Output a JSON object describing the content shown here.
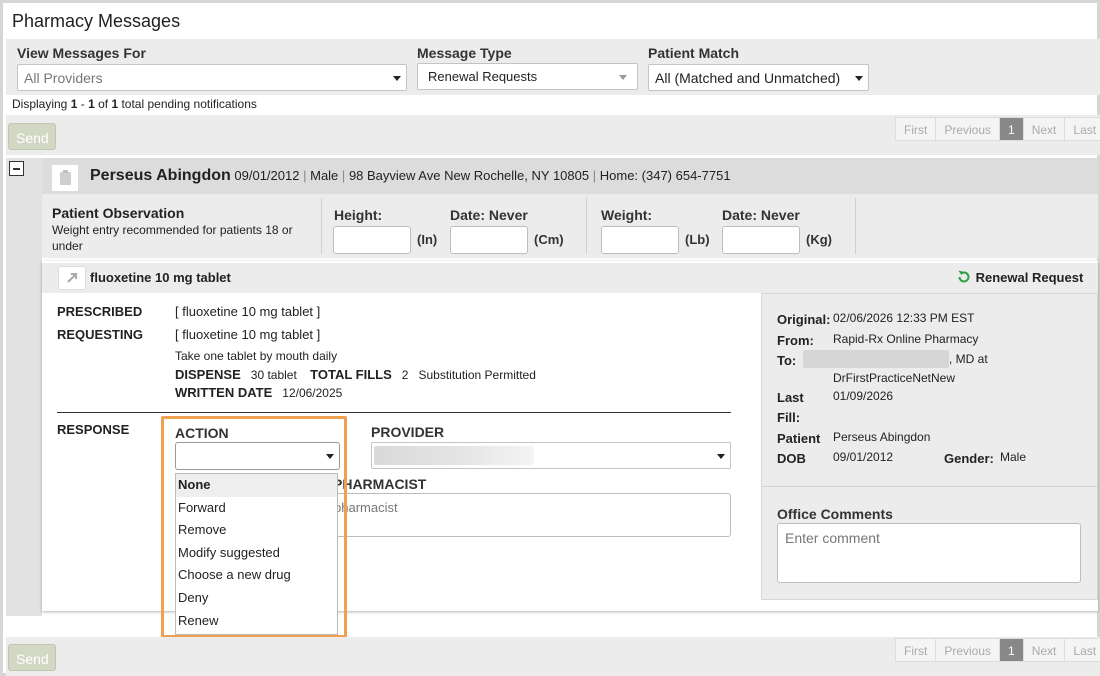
{
  "page": {
    "title": "Pharmacy Messages"
  },
  "filters": {
    "view_messages_for": {
      "label": "View Messages For",
      "placeholder": "All Providers"
    },
    "message_type": {
      "label": "Message Type",
      "value": "Renewal Requests"
    },
    "patient_match": {
      "label": "Patient Match",
      "value": "All (Matched and Unmatched)"
    }
  },
  "summary": {
    "prefix": "Displaying ",
    "from": "1",
    "sep": " - ",
    "to": "1",
    "of": " of ",
    "total": "1",
    "suffix": " total pending notifications"
  },
  "buttons": {
    "send": "Send"
  },
  "pagination": {
    "first": "First",
    "previous": "Previous",
    "current": "1",
    "next": "Next",
    "last": "Last"
  },
  "patient": {
    "name": "Perseus Abingdon",
    "dob": "09/01/2012",
    "gender": "Male",
    "address": "98 Bayview Ave New Rochelle, NY 10805",
    "phone": "Home: (347) 654-7751",
    "sep": "|"
  },
  "observation": {
    "title": "Patient Observation",
    "note": "Weight entry recommended for patients 18 or under",
    "height_label": "Height:",
    "height_date": "Date: Never",
    "unit_in": "(In)",
    "unit_cm": "(Cm)",
    "weight_label": "Weight:",
    "weight_date": "Date: Never",
    "unit_lb": "(Lb)",
    "unit_kg": "(Kg)"
  },
  "rx": {
    "drug": "fluoxetine 10 mg tablet",
    "request_type": "Renewal Request",
    "prescribed_label": "PRESCRIBED",
    "prescribed_value": "[ fluoxetine 10 mg tablet ]",
    "requesting_label": "REQUESTING",
    "requesting_value": "[ fluoxetine 10 mg tablet ]",
    "sig": "Take one tablet by mouth daily",
    "dispense_label": "DISPENSE",
    "dispense_value": "30 tablet",
    "fills_label": "TOTAL FILLS",
    "fills_value": "2",
    "substitution": "Substitution Permitted",
    "written_label": "WRITTEN DATE",
    "written_value": "12/06/2025"
  },
  "response": {
    "label": "RESPONSE",
    "action_label": "ACTION",
    "provider_label": "PROVIDER",
    "pharmacist_label": "PHARMACIST",
    "pharmacist_placeholder": "pharmacist",
    "action_options": [
      "None",
      "Forward",
      "Remove",
      "Modify suggested",
      "Choose a new drug",
      "Deny",
      "Renew"
    ]
  },
  "details": {
    "original_label": "Original:",
    "original_value": "02/06/2026 12:33 PM EST",
    "from_label": "From:",
    "from_value": "Rapid-Rx Online Pharmacy",
    "to_label": "To:",
    "to_suffix": ", MD at",
    "to_practice": "DrFirstPracticeNetNew",
    "last_fill_label_1": "Last",
    "last_fill_label_2": "Fill:",
    "last_fill_value": "01/09/2026",
    "patient_label": "Patient",
    "patient_value": "Perseus Abingdon",
    "dob_label": "DOB",
    "dob_value": "09/01/2012",
    "gender_label": "Gender:",
    "gender_value": "Male"
  },
  "office_comments": {
    "label": "Office Comments",
    "placeholder": "Enter comment"
  },
  "colors": {
    "highlight": "#f0a050",
    "renew_icon": "#2e9e3e",
    "send_disabled": "#d2d8c4"
  },
  "icons": {
    "collapse": "minus-square-icon",
    "patient": "clipboard-icon",
    "expand": "expand-arrow-icon",
    "renewal": "refresh-icon"
  }
}
